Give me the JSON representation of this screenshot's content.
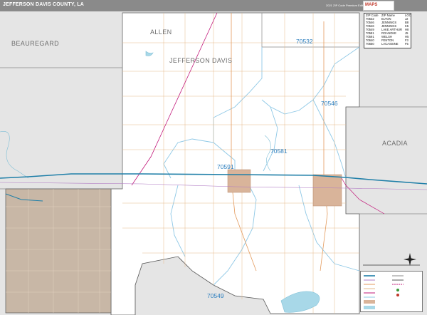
{
  "header": {
    "title": "JEFFERSON DAVIS COUNTY, LA",
    "edition": "2021 ZIP Code Premium Edition",
    "brand_name": "MAPS"
  },
  "map": {
    "county_labels": [
      "ALLEN",
      "JEFFERSON DAVIS",
      "BEAUREGARD",
      "ACADIA"
    ],
    "zip_labels": [
      "70532",
      "70546",
      "70581",
      "70591",
      "70549"
    ],
    "colors": {
      "county_fill": "#ffffff",
      "outside_fill": "#e5e5e5",
      "inset_fill": "#c8b7a6",
      "city_fill": "#d9b49a",
      "water": "#a8d8e8",
      "zip_boundary": "#8ec8e6",
      "highway": "#1f7fa8",
      "railroad": "#c2187a",
      "roads": "#e6b98a"
    }
  },
  "zip_table": {
    "headers": [
      "ZIP Code",
      "ZIP Name",
      "LOC"
    ],
    "rows": [
      [
        "70532",
        "ELTON",
        "J2"
      ],
      [
        "70546",
        "JENNINGS",
        "B8"
      ],
      [
        "70546",
        "JENNINGS",
        "K5"
      ],
      [
        "70549",
        "LAKE ARTHUR",
        "H8"
      ],
      [
        "70581",
        "ROANOKE",
        "J5"
      ],
      [
        "70591",
        "WELSH",
        "H5"
      ],
      [
        "70640",
        "FENTON",
        "F3"
      ],
      [
        "70650",
        "LACASSINE",
        "F5"
      ]
    ]
  }
}
